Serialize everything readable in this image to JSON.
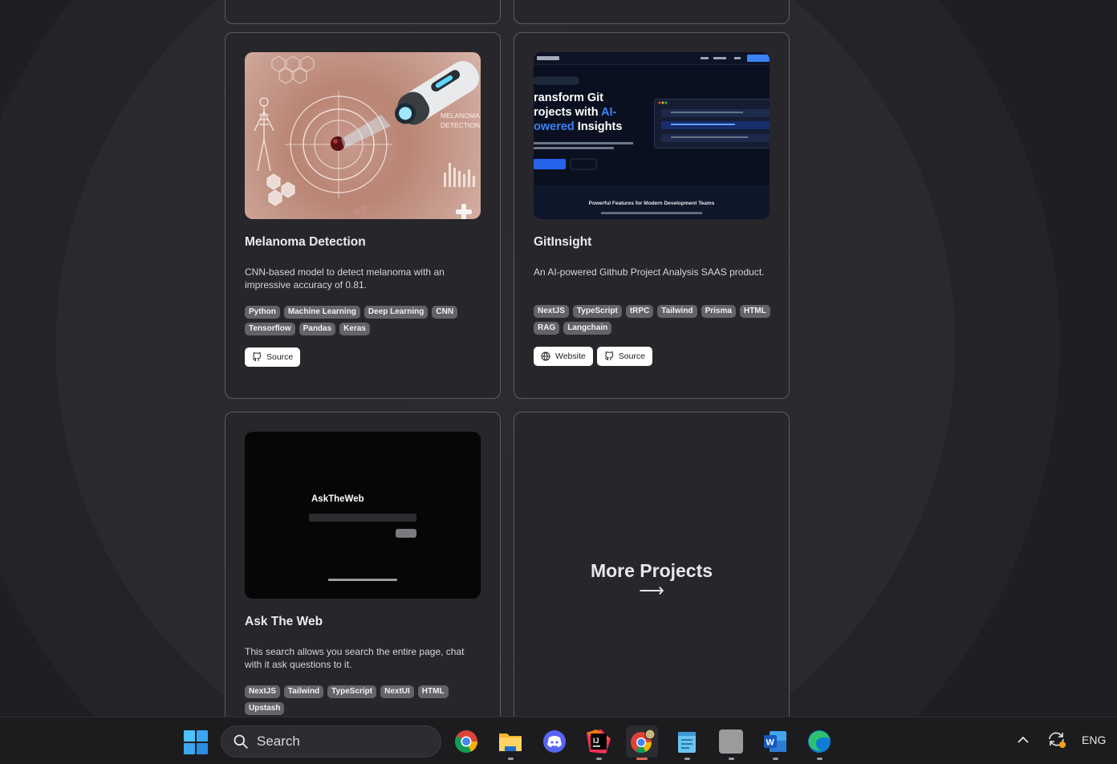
{
  "projects": [
    {
      "title": "Melanoma Detection",
      "description": "CNN-based model to detect melanoma with an impressive accuracy of 0.81.",
      "tags": [
        "Python",
        "Machine Learning",
        "Deep Learning",
        "CNN",
        "Tensorflow",
        "Pandas",
        "Keras"
      ],
      "source_label": "Source",
      "thumb_text": "MELANOMA DETECTION"
    },
    {
      "title": "GitInsight",
      "description": "An AI-powered Github Project Analysis SAAS product.",
      "tags": [
        "NextJS",
        "TypeScript",
        "tRPC",
        "Tailwind",
        "Prisma",
        "HTML",
        "RAG",
        "Langchain"
      ],
      "website_label": "Website",
      "source_label": "Source",
      "thumb": {
        "heading_line1": "ransform Git",
        "heading_line2_plain": "rojects with ",
        "heading_line2_blue": "AI-",
        "heading_line3_blue": "owered",
        "heading_line3_plain": " Insights",
        "footer": "Powerful Features for Modern Development Teams"
      }
    },
    {
      "title": "Ask The Web",
      "description": "This search allows you search the entire page, chat with it ask questions to it.",
      "tags": [
        "NextJS",
        "Tailwind",
        "TypeScript",
        "NextUI",
        "HTML",
        "Upstash"
      ],
      "thumb_title": "AskTheWeb"
    }
  ],
  "more": {
    "label": "More Projects",
    "arrow": "⟶"
  },
  "taskbar": {
    "search_placeholder": "Search",
    "language": "ENG",
    "apps": [
      "chrome-icon",
      "file-explorer-icon",
      "discord-icon",
      "intellij-icon",
      "chrome-profile-icon",
      "notepad-icon",
      "blank-app-icon",
      "word-icon",
      "edge-icon"
    ]
  },
  "colors": {
    "page_bg": "#222226",
    "card_border": "#5b5b62",
    "tag_bg": "#636369",
    "accent_blue": "#3b82f6"
  }
}
